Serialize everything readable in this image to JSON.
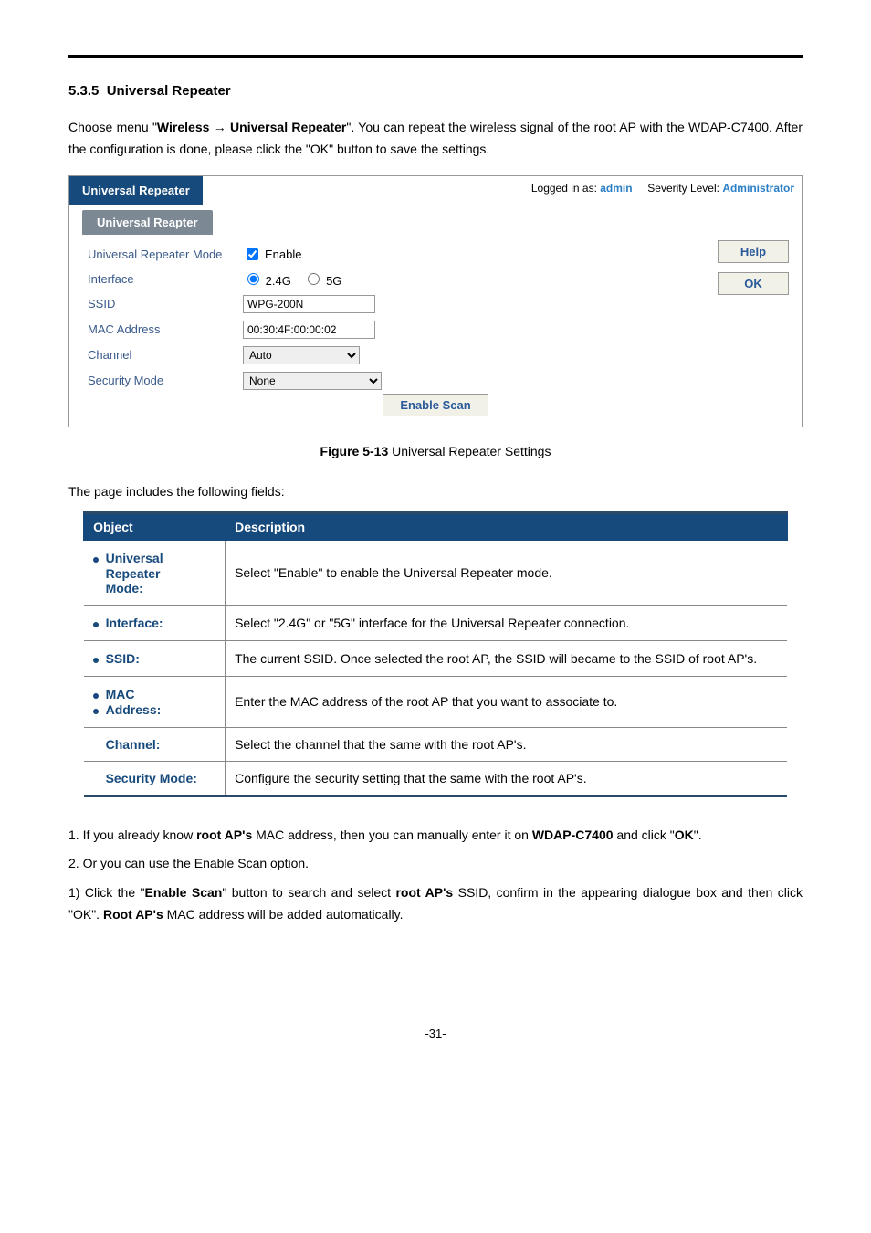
{
  "section": {
    "number": "5.3.5",
    "title": "Universal Repeater"
  },
  "intro": {
    "p1a": "Choose menu \"",
    "p1b": "Wireless → Universal Repeater",
    "p1c": "\". You can repeat the wireless signal of the root AP with the WDAP-C7400. After the configuration is done, please click the \"OK\" button to save the settings."
  },
  "ui": {
    "title": "Universal Repeater",
    "logged_label": "Logged in as: ",
    "logged_user": "admin",
    "sev_label": "Severity Level: ",
    "sev_value": "Administrator",
    "tab": "Universal Reapter",
    "rows": {
      "mode_label": "Universal Repeater Mode",
      "mode_value": "Enable",
      "iface_label": "Interface",
      "iface_opt1": "2.4G",
      "iface_opt2": "5G",
      "ssid_label": "SSID",
      "ssid_value": "WPG-200N",
      "mac_label": "MAC Address",
      "mac_value": "00:30:4F:00:00:02",
      "chan_label": "Channel",
      "chan_value": "Auto",
      "sec_label": "Security Mode",
      "sec_value": "None"
    },
    "help_btn": "Help",
    "ok_btn": "OK",
    "scan_btn": "Enable Scan"
  },
  "figure": {
    "bold": "Figure 5-13",
    "rest": " Universal Repeater Settings"
  },
  "fields_intro": "The page includes the following fields:",
  "table": {
    "h1": "Object",
    "h2": "Description",
    "r1": {
      "obj1": "Universal",
      "obj2": "Repeater",
      "obj3": "Mode:",
      "desc": "Select \"Enable\" to enable the Universal Repeater mode."
    },
    "r2": {
      "obj": "Interface:",
      "desc": "Select \"2.4G\" or \"5G\" interface for the Universal Repeater connection."
    },
    "r3": {
      "obj": "SSID:",
      "desc": "The current SSID. Once selected the root AP, the SSID will became to the SSID of root AP's."
    },
    "r4": {
      "obj1": "MAC",
      "obj2": "Address:",
      "desc": "Enter the MAC address of the root AP that you want to associate to."
    },
    "r5": {
      "obj": "Channel:",
      "desc": "Select the channel that the same with the root AP's."
    },
    "r6": {
      "obj": "Security Mode:",
      "desc": "Configure the security setting that the same with the root AP's."
    }
  },
  "notes": {
    "n1a": "1. If you already know ",
    "n1b": "root AP's",
    "n1c": " MAC address, then you can manually enter it on ",
    "n1d": "WDAP-C7400",
    "n1e": " and click \"",
    "n1f": "OK",
    "n1g": "\".",
    "n2": "2. Or you can use the Enable Scan option.",
    "n3a": "1) Click the \"",
    "n3b": "Enable Scan",
    "n3c": "\" button to search and select ",
    "n3d": "root AP's",
    "n3e": " SSID, confirm in the appearing dialogue box and then click \"OK\". ",
    "n3f": "Root AP's",
    "n3g": " MAC address will be added automatically."
  },
  "page_number": "-31-"
}
